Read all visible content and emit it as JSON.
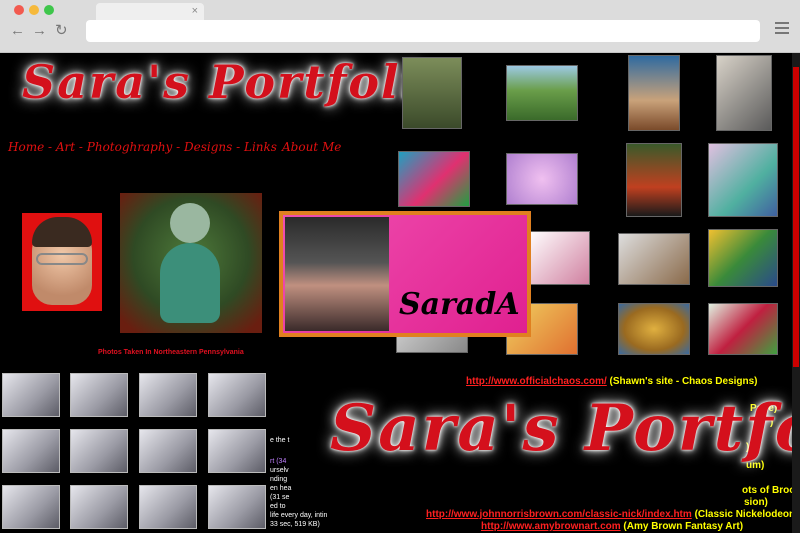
{
  "page": {
    "logo_text": "Sara's Portfolio",
    "nav_links": "Home - Art - Photoghraphy - Designs - Links",
    "about_link": "About Me",
    "photos_caption": "Photos Taken In Northeastern Pennsylvania",
    "sarada_text": "SaradA",
    "links": [
      {
        "url": "http://www.officialchaos.com/",
        "desc": "(Shawn's site - Chaos Designs)"
      },
      {
        "url": "http://www.johnnorrisbrown.com/classic-nick/index.htm",
        "desc": "(Classic Nickelodeon"
      },
      {
        "url": "http://www.amybrownart.com",
        "desc": "(Amy Brown Fantasy Art)"
      }
    ],
    "side_fragments": [
      "Page)",
      ")",
      "um)",
      "ots of Brook",
      "sion)",
      "e the t"
    ],
    "clip_text": [
      "rt (34",
      "urselv",
      "nding",
      "en hea",
      "(31 se",
      "ed to",
      "life every day, intin",
      "33 sec, 519 KB)"
    ]
  },
  "icons": [
    "back-arrow-icon",
    "forward-arrow-icon",
    "reload-icon",
    "menu-icon",
    "close-icon"
  ]
}
